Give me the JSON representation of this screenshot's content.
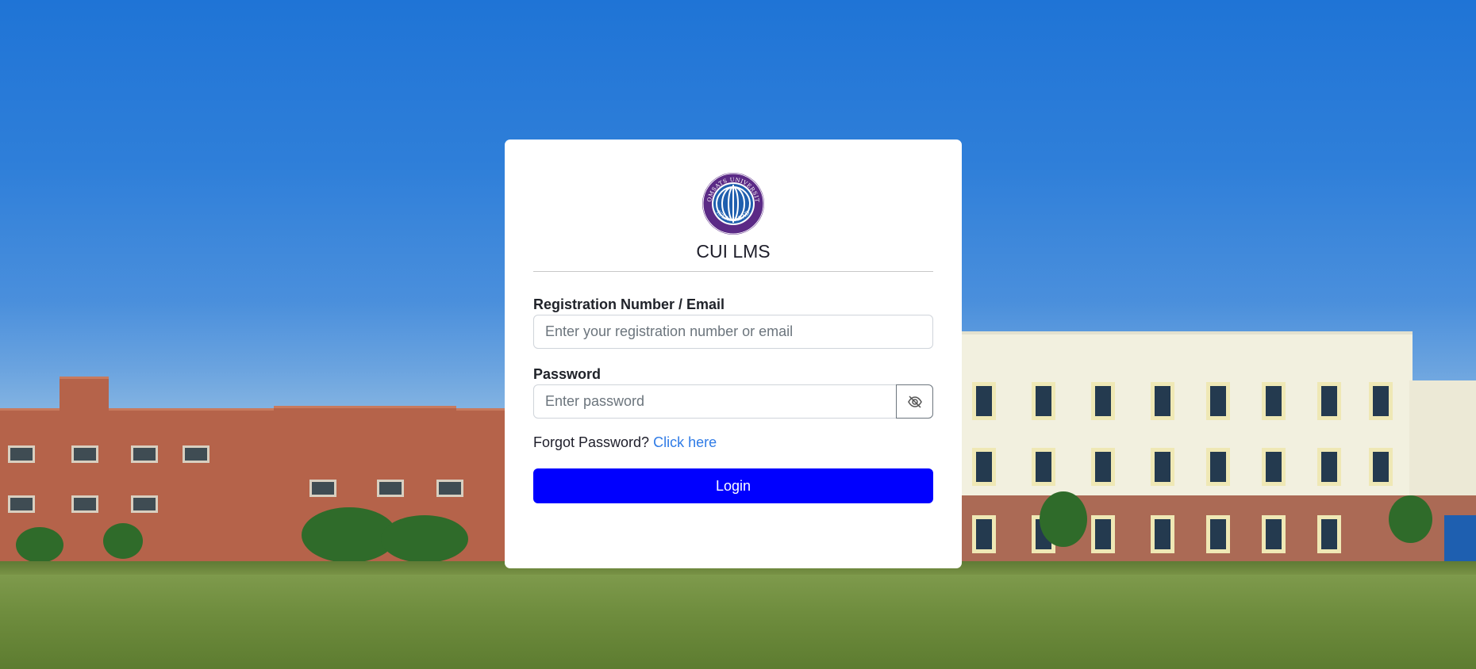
{
  "app": {
    "title": "CUI LMS",
    "logo_text_top": "COMSATS UNIVERSITY",
    "logo_text_bottom": "ISLAMABAD"
  },
  "form": {
    "username_label": "Registration Number / Email",
    "username_placeholder": "Enter your registration number or email",
    "username_value": "",
    "password_label": "Password",
    "password_placeholder": "Enter password",
    "password_value": "",
    "toggle_icon": "eye-slash-icon",
    "forgot_text": "Forgot Password?",
    "forgot_link": "Click here",
    "login_label": "Login"
  },
  "colors": {
    "primary_button": "#0000ff",
    "link": "#2f7be6",
    "logo_ring": "#5b2a86",
    "logo_globe": "#1f5fae"
  }
}
